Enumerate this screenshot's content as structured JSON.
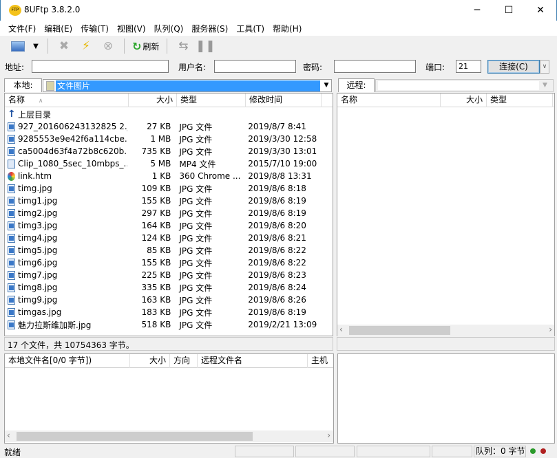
{
  "window": {
    "title": "8UFtp 3.8.2.0",
    "minimize": "─",
    "maximize": "☐",
    "close": "✕"
  },
  "menu": [
    "文件(F)",
    "编辑(E)",
    "传输(T)",
    "视图(V)",
    "队列(Q)",
    "服务器(S)",
    "工具(T)",
    "帮助(H)"
  ],
  "toolbar": {
    "refresh_label": "刷新"
  },
  "connection": {
    "address_label": "地址:",
    "address_value": "",
    "username_label": "用户名:",
    "username_value": "",
    "password_label": "密码:",
    "password_value": "",
    "port_label": "端口:",
    "port_value": "21",
    "connect_label": "连接(C)"
  },
  "local": {
    "tab_label": "本地:",
    "path": "文件图片",
    "columns": [
      "名称",
      "大小",
      "类型",
      "修改时间"
    ],
    "sort_indicator": "∧",
    "files": [
      {
        "name": "上层目录",
        "size": "",
        "type": "",
        "time": "",
        "icon": "up"
      },
      {
        "name": "927_201606243132825 2.j...",
        "size": "27 KB",
        "type": "JPG 文件",
        "time": "2019/8/7 8:41",
        "icon": "img"
      },
      {
        "name": "9285553e9e42f6a114cbe...",
        "size": "1 MB",
        "type": "JPG 文件",
        "time": "2019/3/30 12:58",
        "icon": "img"
      },
      {
        "name": "ca5004d63f4a72b8c620b...",
        "size": "735 KB",
        "type": "JPG 文件",
        "time": "2019/3/30 13:01",
        "icon": "img"
      },
      {
        "name": "Clip_1080_5sec_10mbps_...",
        "size": "5 MB",
        "type": "MP4 文件",
        "time": "2015/7/10 19:00",
        "icon": "vid"
      },
      {
        "name": "link.htm",
        "size": "1 KB",
        "type": "360 Chrome ...",
        "time": "2019/8/8 13:31",
        "icon": "htm"
      },
      {
        "name": "timg.jpg",
        "size": "109 KB",
        "type": "JPG 文件",
        "time": "2019/8/6 8:18",
        "icon": "img"
      },
      {
        "name": "timg1.jpg",
        "size": "155 KB",
        "type": "JPG 文件",
        "time": "2019/8/6 8:19",
        "icon": "img"
      },
      {
        "name": "timg2.jpg",
        "size": "297 KB",
        "type": "JPG 文件",
        "time": "2019/8/6 8:19",
        "icon": "img"
      },
      {
        "name": "timg3.jpg",
        "size": "164 KB",
        "type": "JPG 文件",
        "time": "2019/8/6 8:20",
        "icon": "img"
      },
      {
        "name": "timg4.jpg",
        "size": "124 KB",
        "type": "JPG 文件",
        "time": "2019/8/6 8:21",
        "icon": "img"
      },
      {
        "name": "timg5.jpg",
        "size": "85 KB",
        "type": "JPG 文件",
        "time": "2019/8/6 8:22",
        "icon": "img"
      },
      {
        "name": "timg6.jpg",
        "size": "155 KB",
        "type": "JPG 文件",
        "time": "2019/8/6 8:22",
        "icon": "img"
      },
      {
        "name": "timg7.jpg",
        "size": "225 KB",
        "type": "JPG 文件",
        "time": "2019/8/6 8:23",
        "icon": "img"
      },
      {
        "name": "timg8.jpg",
        "size": "335 KB",
        "type": "JPG 文件",
        "time": "2019/8/6 8:24",
        "icon": "img"
      },
      {
        "name": "timg9.jpg",
        "size": "163 KB",
        "type": "JPG 文件",
        "time": "2019/8/6 8:26",
        "icon": "img"
      },
      {
        "name": "timgas.jpg",
        "size": "183 KB",
        "type": "JPG 文件",
        "time": "2019/8/6 8:19",
        "icon": "img"
      },
      {
        "name": "魅力拉斯维加斯.jpg",
        "size": "518 KB",
        "type": "JPG 文件",
        "time": "2019/2/21 13:09",
        "icon": "img"
      }
    ],
    "summary": "17 个文件，共 10754363 字节。"
  },
  "remote": {
    "tab_label": "远程:",
    "path": "",
    "columns": [
      "名称",
      "大小",
      "类型"
    ]
  },
  "queue": {
    "columns": [
      "本地文件名[0/0 字节])",
      "大小",
      "方向",
      "远程文件名",
      "主机"
    ]
  },
  "status": {
    "text": "就绪",
    "queue": "队列：0 字节"
  },
  "colors": {
    "selection": "#3399ff",
    "accent": "#3c7fb1"
  }
}
